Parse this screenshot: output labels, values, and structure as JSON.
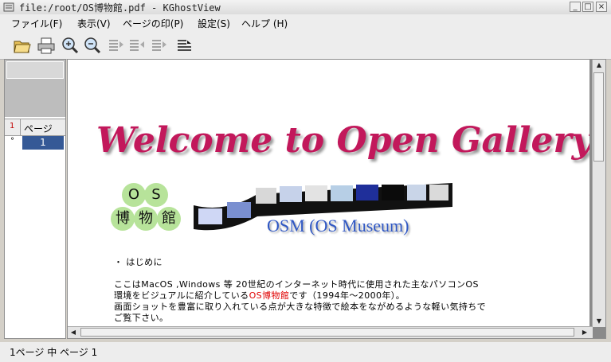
{
  "window": {
    "title": "file:/root/OS博物館.pdf - KGhostView"
  },
  "window_buttons": {
    "minimize": "_",
    "maximize": "□",
    "close": "×"
  },
  "menu": [
    "ファイル(F)",
    "表示(V)",
    "ページの印(P)",
    "設定(S)",
    "ヘルプ (H)"
  ],
  "toolbar": {
    "icons": [
      "open-icon",
      "print-icon",
      "zoom-in-icon",
      "zoom-out-icon",
      "mark-page-icon",
      "mark-next-icon",
      "unmark-icon",
      "toggle-mark-icon"
    ]
  },
  "page_list": {
    "header_label": "ページ",
    "header_marker": "1",
    "rows": [
      {
        "marker": "°",
        "number": "1"
      }
    ]
  },
  "document": {
    "welcome_title": "Welcome to Open Gallery",
    "logo_chars": [
      "O",
      "S",
      "博",
      "物",
      "館"
    ],
    "osm_title": "OSM (OS Museum)",
    "bullet_heading": "・ はじめに",
    "line1": "ここはMacOS ,Windows 等 20世紀のインターネット時代に使用された主なパソコンOS",
    "line2_prefix": "環境をビジュアルに紹介している",
    "line2_highlight": "OS博物館",
    "line2_suffix": "です（1994年～2000年）。",
    "line3": "画面ショットを豊富に取り入れている点が大きな特徴で絵本をながめるような軽い気持ちで",
    "line4": "ご覧下さい。"
  },
  "status": {
    "text": "1ページ 中 ページ 1"
  },
  "colors": {
    "accent": "#355996",
    "welcome": "#c2185b",
    "osm_title": "#2f57c4",
    "highlight": "#e00000"
  }
}
